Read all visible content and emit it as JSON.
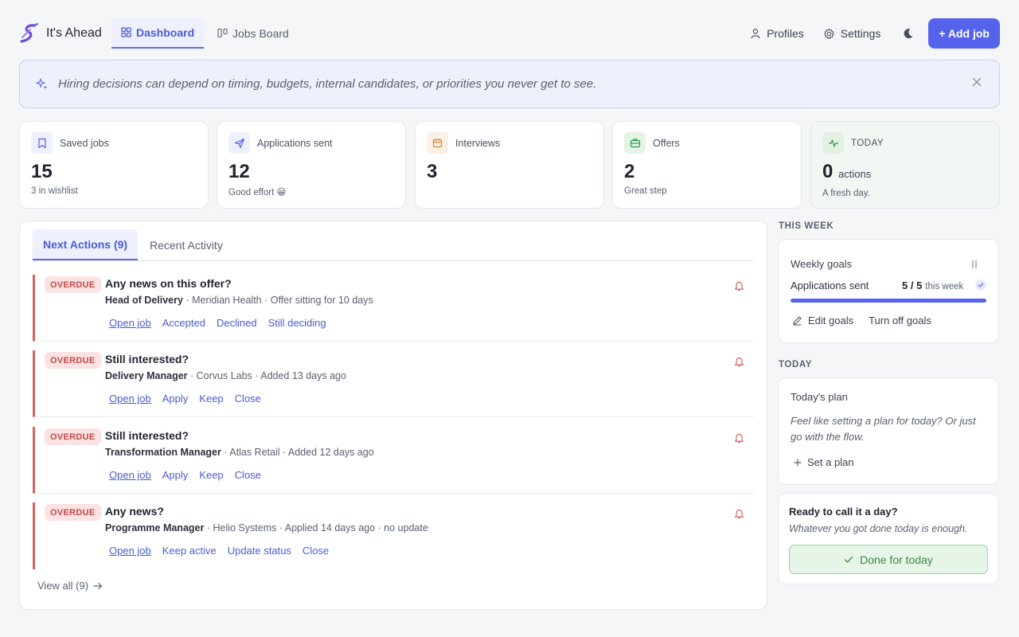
{
  "app": {
    "name": "It's Ahead"
  },
  "nav": {
    "tabs": [
      {
        "label": "Dashboard",
        "icon": "grid-icon",
        "active": true
      },
      {
        "label": "Jobs Board",
        "icon": "kanban-icon",
        "active": false
      }
    ],
    "profiles": "Profiles",
    "settings": "Settings",
    "theme_icon": "moon-icon",
    "add_job": "+ Add job"
  },
  "banner": {
    "text": "Hiring decisions can depend on timing, budgets, internal candidates, or priorities you never get to see."
  },
  "stats": [
    {
      "label": "Saved jobs",
      "value": "15",
      "sub": "3 in wishlist",
      "icon": "bookmark-icon",
      "color": "#5563ec"
    },
    {
      "label": "Applications sent",
      "value": "12",
      "sub": "Good effort 😀",
      "icon": "send-icon",
      "color": "#5563ec"
    },
    {
      "label": "Interviews",
      "value": "3",
      "sub": "",
      "icon": "calendar-icon",
      "color": "#e0843c"
    },
    {
      "label": "Offers",
      "value": "2",
      "sub": "Great step",
      "icon": "briefcase-icon",
      "color": "#2f9a48"
    },
    {
      "label": "TODAY",
      "value": "0",
      "unit": "actions",
      "sub": "A fresh day.",
      "icon": "activity-icon",
      "color": "#2f9a48"
    }
  ],
  "panel": {
    "tabs": [
      {
        "label": "Next Actions (9)",
        "active": true
      },
      {
        "label": "Recent Activity",
        "active": false
      }
    ],
    "actions": [
      {
        "badge": "OVERDUE",
        "title": "Any news on this offer?",
        "role": "Head of Delivery",
        "meta": " · Meridian Health · Offer sitting for 10 days",
        "links": [
          "Open job",
          "Accepted",
          "Declined",
          "Still deciding"
        ]
      },
      {
        "badge": "OVERDUE",
        "title": "Still interested?",
        "role": "Delivery Manager",
        "meta": " · Corvus Labs · Added 13 days ago",
        "links": [
          "Open job",
          "Apply",
          "Keep",
          "Close"
        ]
      },
      {
        "badge": "OVERDUE",
        "title": "Still interested?",
        "role": "Transformation Manager",
        "meta": " · Atlas Retail · Added 12 days ago",
        "links": [
          "Open job",
          "Apply",
          "Keep",
          "Close"
        ]
      },
      {
        "badge": "OVERDUE",
        "title": "Any news?",
        "role": "Programme Manager",
        "meta": " · Helio Systems · Applied 14 days ago · no update",
        "links": [
          "Open job",
          "Keep active",
          "Update status",
          "Close"
        ]
      }
    ],
    "view_all": "View all (9)"
  },
  "week": {
    "section": "THIS WEEK",
    "title": "Weekly goals",
    "goal_label": "Applications sent",
    "goal_count": "5 / 5",
    "goal_suffix": "this week",
    "progress": 1.0,
    "edit": "Edit goals",
    "turn_off": "Turn off goals"
  },
  "today": {
    "section": "TODAY",
    "title": "Today's plan",
    "prompt": "Feel like setting a plan for today? Or just go with the flow.",
    "set_plan": "Set a plan"
  },
  "end_day": {
    "title": "Ready to call it a day?",
    "sub": "Whatever you got done today is enough.",
    "button": "Done for today"
  }
}
